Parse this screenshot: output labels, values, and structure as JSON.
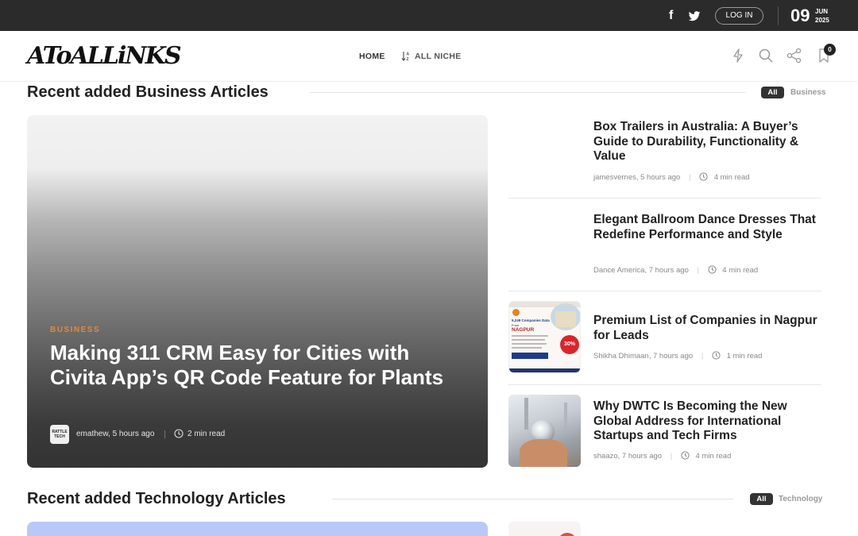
{
  "topbar": {
    "login_label": "LOG IN",
    "date_day": "09",
    "date_month": "JUN",
    "date_year": "2025"
  },
  "header": {
    "logo_text": "AToALLiNKS",
    "nav": [
      {
        "label": "HOME"
      },
      {
        "label": "ALL NICHE"
      }
    ],
    "bookmark_count": "0"
  },
  "sections": [
    {
      "title": "Recent added Business Articles",
      "filter_all": "All",
      "filter_category": "Business"
    },
    {
      "title": "Recent added Technology Articles",
      "filter_all": "All",
      "filter_category": "Technology"
    }
  ],
  "featured": {
    "category": "BUSINESS",
    "title": "Making 311 CRM Easy for Cities with Civita App’s QR Code Feature for Plants",
    "avatar_text": "RATTLE TECH",
    "author_time": "emathew, 5 hours ago",
    "read_time": "2 min read"
  },
  "articles": [
    {
      "title": "Box Trailers in Australia: A Buyer’s Guide to Durability, Functionality & Value",
      "author_time": "jamesvernes, 5 hours ago",
      "read_time": "4 min read"
    },
    {
      "title": "Elegant Ballroom Dance Dresses That Redefine Performance and Style",
      "author_time": "Dance America, 7 hours ago",
      "read_time": "4 min read"
    },
    {
      "title": "Premium List of Companies in Nagpur for Leads",
      "author_time": "Shikha Dhimaan, 7 hours ago",
      "read_time": "1 min read",
      "thumb_text": {
        "count": "5,249 Companies Data",
        "from": "From",
        "city": "NAGPUR",
        "discount": "30%"
      }
    },
    {
      "title": "Why DWTC Is Becoming the New Global Address for International Startups and Tech Firms",
      "author_time": "shaazo, 7 hours ago",
      "read_time": "4 min read"
    }
  ],
  "colors": {
    "topbar_bg": "#2b2b2b",
    "category_accent": "#e08a3a",
    "pill_bg": "#333333",
    "tech_card": "#b9c9f7"
  },
  "icons": [
    "facebook-icon",
    "twitter-icon",
    "sort-icon",
    "flash-icon",
    "search-icon",
    "share-icon",
    "bookmark-icon",
    "clock-icon"
  ]
}
